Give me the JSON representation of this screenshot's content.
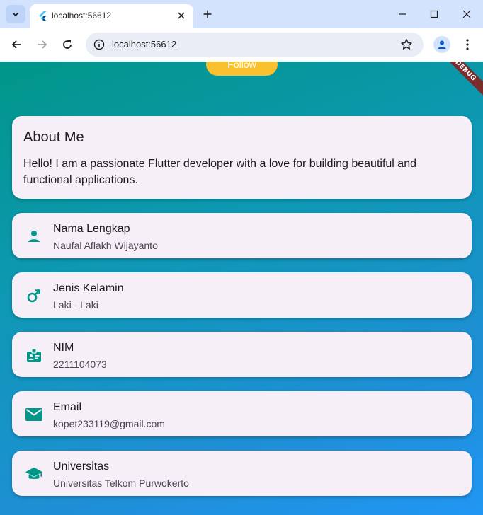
{
  "browser": {
    "tab_title": "localhost:56612",
    "url": "localhost:56612"
  },
  "app": {
    "follow_label": "Follow",
    "debug_label": "DEBUG",
    "about": {
      "title": "About Me",
      "text": "Hello! I am a passionate Flutter developer with a love for building beautiful and functional applications."
    },
    "info": [
      {
        "icon": "person-icon",
        "label": "Nama Lengkap",
        "value": "Naufal Aflakh Wijayanto"
      },
      {
        "icon": "male-icon",
        "label": "Jenis Kelamin",
        "value": "Laki - Laki"
      },
      {
        "icon": "badge-icon",
        "label": "NIM",
        "value": "2211104073"
      },
      {
        "icon": "email-icon",
        "label": "Email",
        "value": "kopet233119@gmail.com"
      },
      {
        "icon": "school-icon",
        "label": "Universitas",
        "value": "Universitas Telkom Purwokerto"
      }
    ]
  },
  "colors": {
    "accent": "#009688",
    "follow_button": "#fbc02d",
    "card_background": "#f6eff7"
  }
}
